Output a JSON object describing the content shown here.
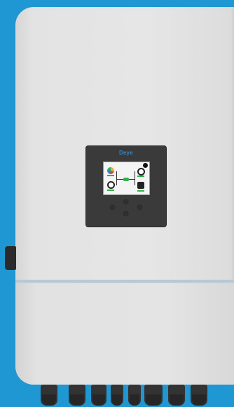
{
  "device": {
    "brand_logo": "Deye",
    "display": {
      "icons": [
        "solar-icon",
        "battery-icon",
        "grid-icon",
        "home-icon"
      ],
      "flow_color": "#2fb34a"
    },
    "accent_color": "#2f86c9",
    "background_color": "#1f97d2"
  }
}
